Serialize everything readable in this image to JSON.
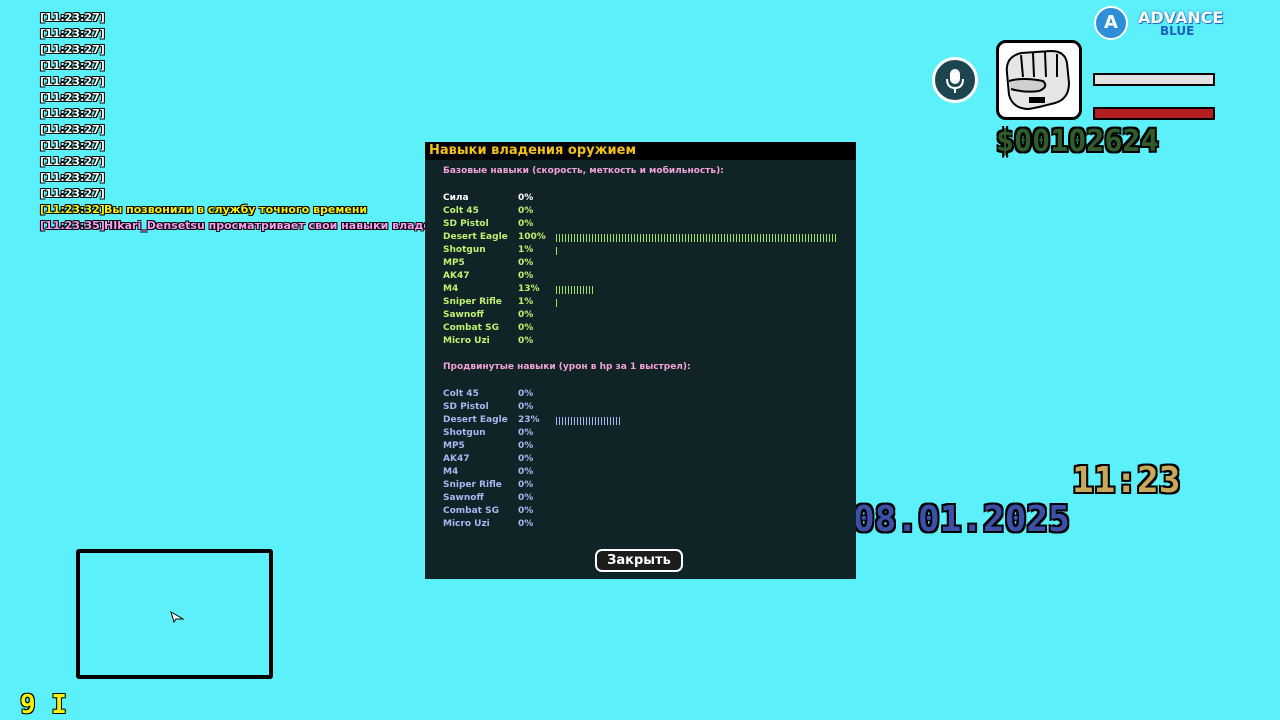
{
  "chat": {
    "lines": [
      {
        "time": "[11:23:27]",
        "text": ""
      },
      {
        "time": "[11:23:27]",
        "text": ""
      },
      {
        "time": "[11:23:27]",
        "text": ""
      },
      {
        "time": "[11:23:27]",
        "text": ""
      },
      {
        "time": "[11:23:27]",
        "text": ""
      },
      {
        "time": "[11:23:27]",
        "text": ""
      },
      {
        "time": "[11:23:27]",
        "text": ""
      },
      {
        "time": "[11:23:27]",
        "text": ""
      },
      {
        "time": "[11:23:27]",
        "text": ""
      },
      {
        "time": "[11:23:27]",
        "text": ""
      },
      {
        "time": "[11:23:27]",
        "text": ""
      },
      {
        "time": "[11:23:27]",
        "text": ""
      },
      {
        "time": "[11:23:32]",
        "text": "Вы позвонили в службу точного времени"
      },
      {
        "time": "[11:23:35]",
        "text": "HIkari_Densetsu просматривает свои навыки владен"
      }
    ]
  },
  "logo": {
    "letter": "A",
    "line1": "ADVANCE",
    "line2": "BLUE"
  },
  "hud": {
    "money": "$00102624",
    "clock": "11:23",
    "date": "08.01.2025",
    "ammo": "9 I",
    "armor_level": 1.0,
    "health_level": 1.0
  },
  "dialog": {
    "title": "Навыки владения оружием",
    "basic_title": "Базовые навыки (скорость, меткость и мобильность):",
    "basic": [
      {
        "name": "Сила",
        "pct": "0%",
        "level": 0
      },
      {
        "name": "Colt 45",
        "pct": "0%",
        "level": 0
      },
      {
        "name": "SD Pistol",
        "pct": "0%",
        "level": 0
      },
      {
        "name": "Desert Eagle",
        "pct": "100%",
        "level": 100
      },
      {
        "name": "Shotgun",
        "pct": "1%",
        "level": 1
      },
      {
        "name": "MP5",
        "pct": "0%",
        "level": 0
      },
      {
        "name": "AK47",
        "pct": "0%",
        "level": 0
      },
      {
        "name": "M4",
        "pct": "13%",
        "level": 13
      },
      {
        "name": "Sniper Rifle",
        "pct": "1%",
        "level": 1
      },
      {
        "name": "Sawnoff",
        "pct": "0%",
        "level": 0
      },
      {
        "name": "Combat SG",
        "pct": "0%",
        "level": 0
      },
      {
        "name": "Micro Uzi",
        "pct": "0%",
        "level": 0
      }
    ],
    "advanced_title": "Продвинутые навыки (урон в hp за 1 выстрел):",
    "advanced": [
      {
        "name": "Colt 45",
        "pct": "0%",
        "level": 0
      },
      {
        "name": "SD Pistol",
        "pct": "0%",
        "level": 0
      },
      {
        "name": "Desert Eagle",
        "pct": "23%",
        "level": 23
      },
      {
        "name": "Shotgun",
        "pct": "0%",
        "level": 0
      },
      {
        "name": "MP5",
        "pct": "0%",
        "level": 0
      },
      {
        "name": "AK47",
        "pct": "0%",
        "level": 0
      },
      {
        "name": "M4",
        "pct": "0%",
        "level": 0
      },
      {
        "name": "Sniper Rifle",
        "pct": "0%",
        "level": 0
      },
      {
        "name": "Sawnoff",
        "pct": "0%",
        "level": 0
      },
      {
        "name": "Combat SG",
        "pct": "0%",
        "level": 0
      },
      {
        "name": "Micro Uzi",
        "pct": "0%",
        "level": 0
      }
    ],
    "close_label": "Закрыть"
  },
  "colors": {
    "background": "#5cf0fb",
    "dialog_bg": "#102327",
    "title_color": "#f3c018",
    "basic_text": "#c0f070",
    "advanced_text": "#a8b6f2",
    "section_title": "#f2a2d6"
  },
  "icons": {
    "weapon": "fist-icon",
    "voice": "microphone-icon",
    "radar_player": "player-arrow-icon"
  }
}
